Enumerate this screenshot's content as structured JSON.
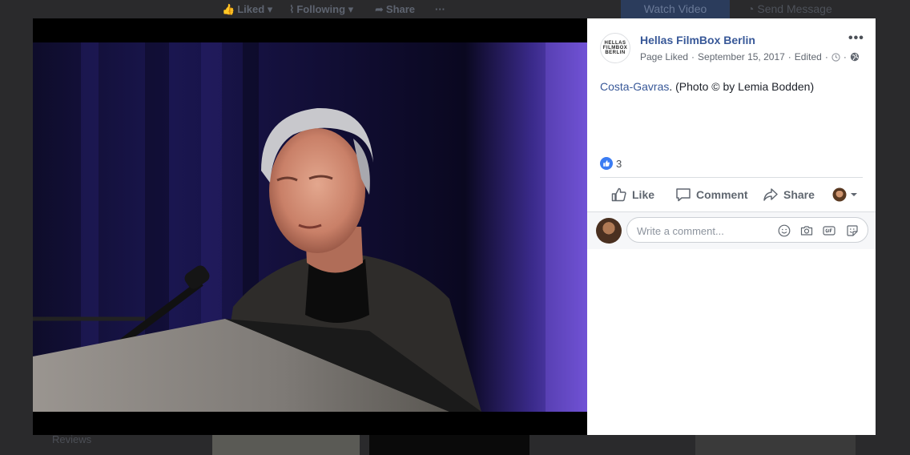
{
  "background": {
    "topbar": {
      "liked": "Liked",
      "following": "Following",
      "share": "Share",
      "more": "···",
      "watch_video": "Watch Video",
      "send_message": "Send Message"
    },
    "reviews": "Reviews"
  },
  "post": {
    "page_name": "Hellas FilmBox Berlin",
    "avatar_logo": [
      "HELLAS",
      "FILMBOX",
      "BERLIN"
    ],
    "meta": {
      "liked": "Page Liked",
      "date": "September 15, 2017",
      "edited": "Edited"
    },
    "caption_link": "Costa-Gavras",
    "caption_text": ". (Photo © by Lemia Bodden)",
    "reaction_count": "3",
    "actions": {
      "like": "Like",
      "comment": "Comment",
      "share": "Share"
    },
    "comment_placeholder": "Write a comment..."
  },
  "colors": {
    "link": "#385898",
    "like_blue": "#3b7cf3",
    "action_gray": "#606770"
  }
}
